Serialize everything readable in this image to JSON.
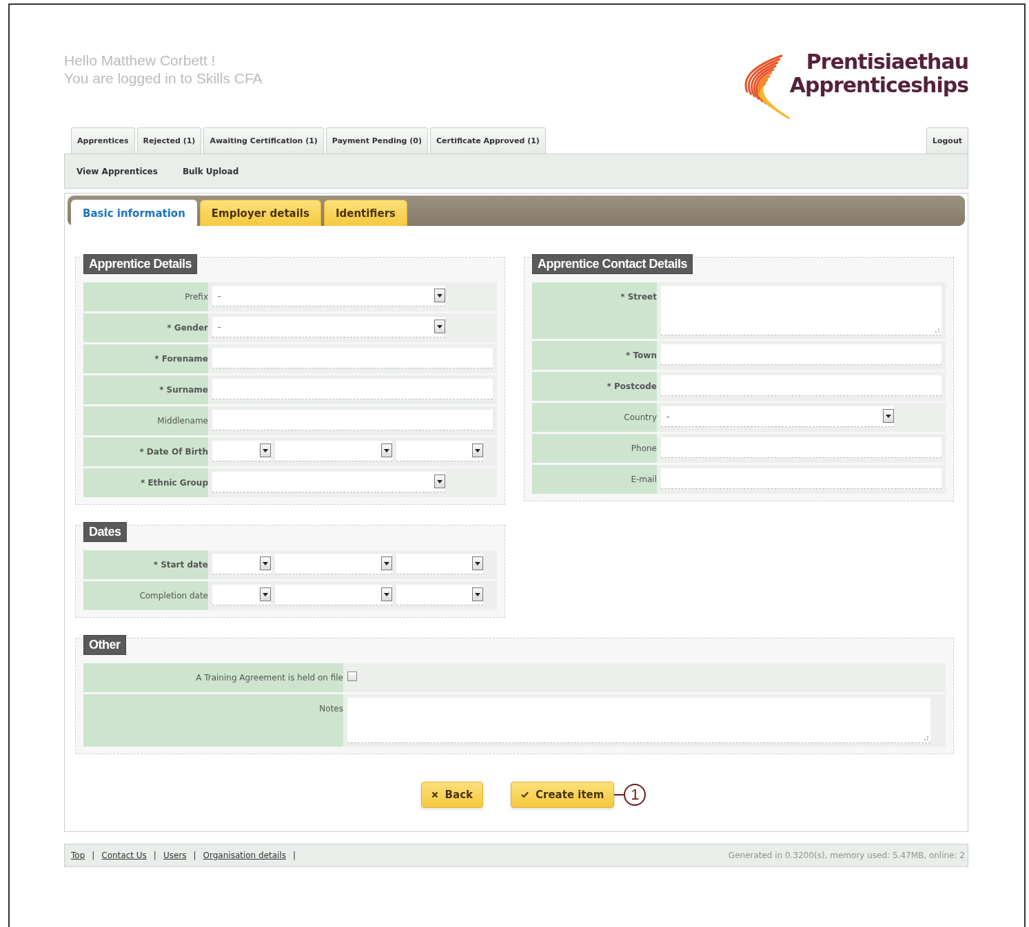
{
  "greeting": [
    "Hello Matthew Corbett !",
    "You are logged in to Skills CFA"
  ],
  "logo": {
    "line_1": "Prentisiaethau",
    "line_2": "Apprenticeships"
  },
  "main_tabs": [
    {
      "label": "Apprentices"
    },
    {
      "label": "Rejected (1)"
    },
    {
      "label": "Awaiting Certification (1)"
    },
    {
      "label": "Payment Pending (0)"
    },
    {
      "label": "Certificate Approved (1)"
    }
  ],
  "logout": "Logout",
  "sub_nav": [
    "View Apprentices",
    "Bulk Upload"
  ],
  "form_tabs": [
    {
      "label": "Basic information",
      "selected": true
    },
    {
      "label": "Employer details",
      "selected": false
    },
    {
      "label": "Identifiers",
      "selected": false
    }
  ],
  "apprentice_details": {
    "title": "Apprentice Details",
    "fields": [
      {
        "label": "Prefix",
        "kind": "select",
        "required": false,
        "value": "-"
      },
      {
        "label": "* Gender",
        "kind": "select",
        "required": true,
        "value": "-"
      },
      {
        "label": "* Forename",
        "kind": "text",
        "required": true
      },
      {
        "label": "* Surname",
        "kind": "text",
        "required": true
      },
      {
        "label": "Middlename",
        "kind": "text",
        "required": false
      },
      {
        "label": "* Date Of Birth",
        "kind": "date",
        "required": true
      },
      {
        "label": "* Ethnic Group",
        "kind": "select",
        "required": true
      }
    ]
  },
  "contact_details": {
    "title": "Apprentice Contact Details",
    "fields": [
      {
        "label": "* Street",
        "kind": "textarea",
        "required": true
      },
      {
        "label": "* Town",
        "kind": "text",
        "required": true
      },
      {
        "label": "* Postcode",
        "kind": "text",
        "required": true
      },
      {
        "label": "Country",
        "kind": "select",
        "required": false,
        "value": "-"
      },
      {
        "label": "Phone",
        "kind": "text",
        "required": false
      },
      {
        "label": "E-mail",
        "kind": "text",
        "required": false
      }
    ]
  },
  "dates": {
    "title": "Dates",
    "fields": [
      {
        "label": "* Start date",
        "kind": "date",
        "required": true
      },
      {
        "label": "Completion date",
        "kind": "date",
        "required": false
      }
    ]
  },
  "other": {
    "title": "Other",
    "fields": [
      {
        "label": "A Training Agreement is held on file",
        "kind": "checkbox",
        "required": false,
        "checked": false
      },
      {
        "label": "Notes",
        "kind": "textarea",
        "required": false
      }
    ]
  },
  "buttons": [
    {
      "label": "Back",
      "kind": "back"
    },
    {
      "label": "Create item",
      "kind": "create"
    }
  ],
  "callout": {
    "label": "1"
  },
  "footer": {
    "links": [
      "Top",
      "Contact Us",
      "Users",
      "Organisation details"
    ],
    "separator": "|",
    "status": "Generated in 0.3200(s), memory used: 5.47MB, online: 2"
  }
}
